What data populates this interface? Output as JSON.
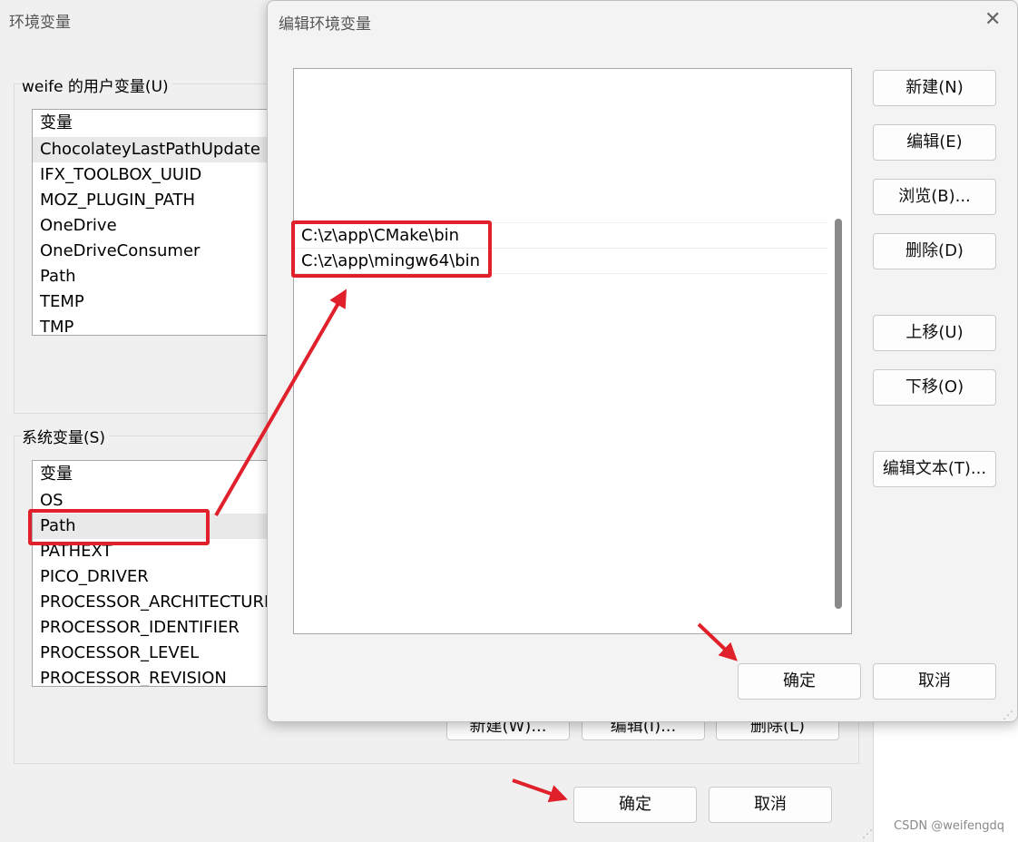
{
  "back_window": {
    "title": "环境变量",
    "user_vars": {
      "label": "weife 的用户变量(U)",
      "header": "变量",
      "items": [
        "ChocolateyLastPathUpdate",
        "IFX_TOOLBOX_UUID",
        "MOZ_PLUGIN_PATH",
        "OneDrive",
        "OneDriveConsumer",
        "Path",
        "TEMP",
        "TMP"
      ]
    },
    "sys_vars": {
      "label": "系统变量(S)",
      "header": "变量",
      "items": [
        "OS",
        "Path",
        "PATHEXT",
        "PICO_DRIVER",
        "PROCESSOR_ARCHITECTURE",
        "PROCESSOR_IDENTIFIER",
        "PROCESSOR_LEVEL",
        "PROCESSOR_REVISION"
      ]
    },
    "sys_buttons": {
      "new": "新建(W)...",
      "edit": "编辑(I)...",
      "delete": "删除(L)"
    },
    "ok": "确定",
    "cancel": "取消"
  },
  "dialog": {
    "title": "编辑环境变量",
    "close_glyph": "✕",
    "paths": [
      "C:\\z\\app\\CMake\\bin",
      "C:\\z\\app\\mingw64\\bin"
    ],
    "buttons": {
      "new": "新建(N)",
      "edit": "编辑(E)",
      "browse": "浏览(B)...",
      "delete": "删除(D)",
      "move_up": "上移(U)",
      "move_down": "下移(O)",
      "edit_text": "编辑文本(T)..."
    },
    "ok": "确定",
    "cancel": "取消"
  },
  "watermark": "CSDN @weifengdq",
  "colors": {
    "annotation_red": "#e0202a"
  }
}
